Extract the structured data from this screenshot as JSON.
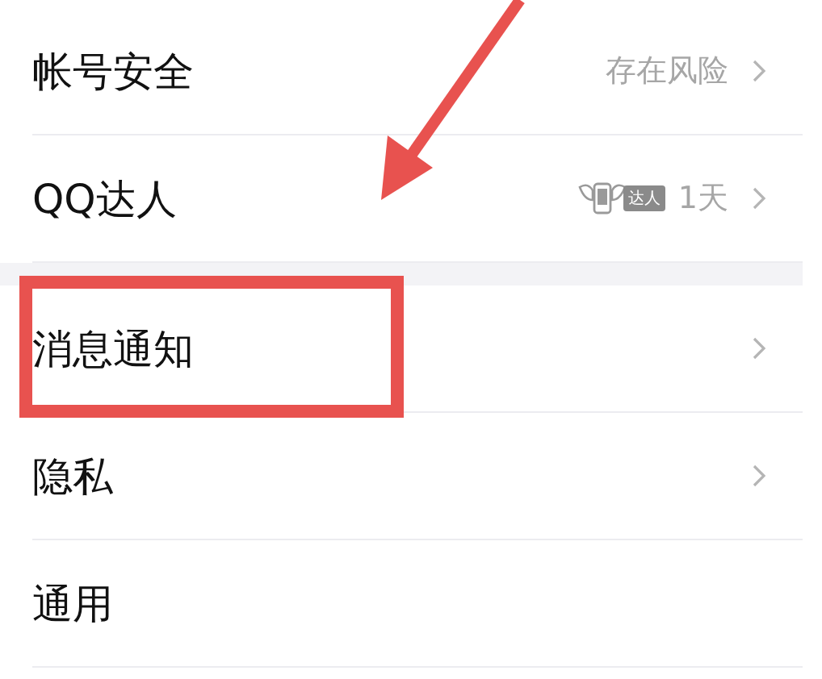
{
  "groups": [
    {
      "items": [
        {
          "label": "帐号安全",
          "value": "存在风险",
          "chevron": true,
          "highlighted": false
        },
        {
          "label": "QQ达人",
          "badge": "达人",
          "value": "1天",
          "chevron": true,
          "highlighted": false
        }
      ]
    },
    {
      "items": [
        {
          "label": "消息通知",
          "chevron": true,
          "highlighted": true
        },
        {
          "label": "隐私",
          "chevron": true,
          "highlighted": false
        },
        {
          "label": "通用",
          "chevron": false,
          "highlighted": false
        }
      ]
    }
  ]
}
